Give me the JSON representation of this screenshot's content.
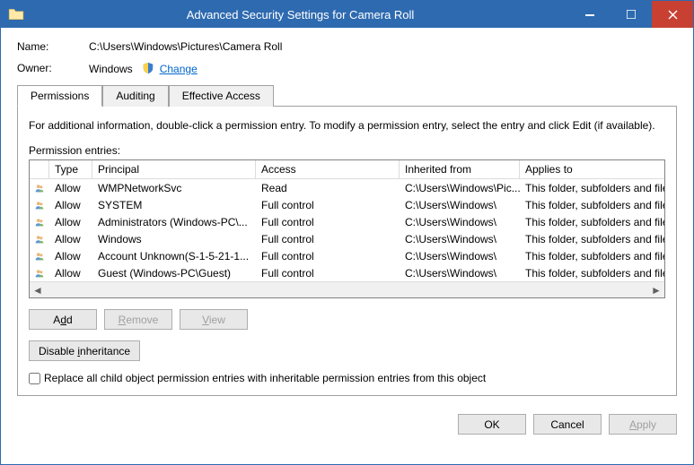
{
  "window": {
    "title": "Advanced Security Settings for Camera Roll"
  },
  "meta": {
    "name_label": "Name:",
    "name_value": "C:\\Users\\Windows\\Pictures\\Camera Roll",
    "owner_label": "Owner:",
    "owner_value": "Windows",
    "change_label": "Change"
  },
  "tabs": {
    "permissions": "Permissions",
    "auditing": "Auditing",
    "effective": "Effective Access"
  },
  "panel": {
    "info": "For additional information, double-click a permission entry. To modify a permission entry, select the entry and click Edit (if available).",
    "entries_label": "Permission entries:",
    "columns": {
      "type": "Type",
      "principal": "Principal",
      "access": "Access",
      "inherited": "Inherited from",
      "applies": "Applies to"
    },
    "entries": [
      {
        "type": "Allow",
        "principal": "WMPNetworkSvc",
        "access": "Read",
        "inherited": "C:\\Users\\Windows\\Pic...",
        "applies": "This folder, subfolders and files"
      },
      {
        "type": "Allow",
        "principal": "SYSTEM",
        "access": "Full control",
        "inherited": "C:\\Users\\Windows\\",
        "applies": "This folder, subfolders and files"
      },
      {
        "type": "Allow",
        "principal": "Administrators (Windows-PC\\...",
        "access": "Full control",
        "inherited": "C:\\Users\\Windows\\",
        "applies": "This folder, subfolders and files"
      },
      {
        "type": "Allow",
        "principal": "Windows",
        "access": "Full control",
        "inherited": "C:\\Users\\Windows\\",
        "applies": "This folder, subfolders and files"
      },
      {
        "type": "Allow",
        "principal": "Account Unknown(S-1-5-21-1...",
        "access": "Full control",
        "inherited": "C:\\Users\\Windows\\",
        "applies": "This folder, subfolders and files"
      },
      {
        "type": "Allow",
        "principal": "Guest (Windows-PC\\Guest)",
        "access": "Full control",
        "inherited": "C:\\Users\\Windows\\",
        "applies": "This folder, subfolders and files"
      }
    ],
    "buttons": {
      "add": "Add",
      "remove": "Remove",
      "view": "View",
      "disable_inheritance": "Disable inheritance"
    },
    "replace_checkbox": "Replace all child object permission entries with inheritable permission entries from this object"
  },
  "footer": {
    "ok": "OK",
    "cancel": "Cancel",
    "apply": "Apply"
  }
}
